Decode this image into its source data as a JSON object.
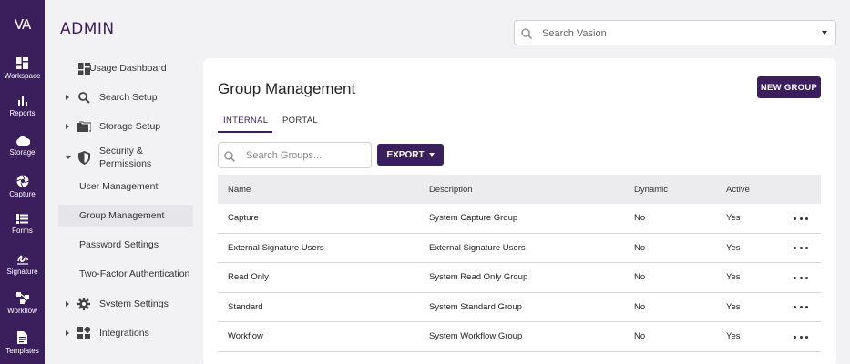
{
  "rail": {
    "logo": "VA",
    "items": [
      {
        "label": "Workspace",
        "icon": "dashboard-icon"
      },
      {
        "label": "Reports",
        "icon": "bar-chart-icon"
      },
      {
        "label": "Storage",
        "icon": "cloud-icon"
      },
      {
        "label": "Capture",
        "icon": "aperture-icon"
      },
      {
        "label": "Forms",
        "icon": "form-icon"
      },
      {
        "label": "Signature",
        "icon": "signature-icon"
      },
      {
        "label": "Workflow",
        "icon": "workflow-icon"
      },
      {
        "label": "Templates",
        "icon": "document-icon"
      }
    ]
  },
  "brand": "ADMIN",
  "nav": {
    "items": [
      {
        "label": "Usage Dashboard"
      },
      {
        "label": "Search Setup"
      },
      {
        "label": "Storage Setup"
      },
      {
        "label": "Security &",
        "label2": "Permissions"
      },
      {
        "label": "System Settings"
      },
      {
        "label": "Integrations"
      }
    ],
    "sub": [
      {
        "label": "User Management"
      },
      {
        "label": "Group Management"
      },
      {
        "label": "Password Settings"
      },
      {
        "label": "Two-Factor Authentication"
      }
    ]
  },
  "topsearch": {
    "placeholder": "Search Vasion"
  },
  "main": {
    "title": "Group Management",
    "new_group": "NEW GROUP",
    "tabs": [
      {
        "label": "INTERNAL"
      },
      {
        "label": "PORTAL"
      }
    ],
    "search_placeholder": "Search Groups...",
    "export_label": "EXPORT",
    "columns": [
      "Name",
      "Description",
      "Dynamic",
      "Active"
    ],
    "rows": [
      {
        "name": "Capture",
        "description": "System Capture Group",
        "dynamic": "No",
        "active": "Yes"
      },
      {
        "name": "External Signature Users",
        "description": "External Signature Users",
        "dynamic": "No",
        "active": "Yes"
      },
      {
        "name": "Read Only",
        "description": "System Read Only Group",
        "dynamic": "No",
        "active": "Yes"
      },
      {
        "name": "Standard",
        "description": "System Standard Group",
        "dynamic": "No",
        "active": "Yes"
      },
      {
        "name": "Workflow",
        "description": "System Workflow Group",
        "dynamic": "No",
        "active": "Yes"
      }
    ]
  },
  "colors": {
    "brand": "#3b1f5c",
    "background": "#f2f2f4",
    "header_row": "#ececee"
  }
}
